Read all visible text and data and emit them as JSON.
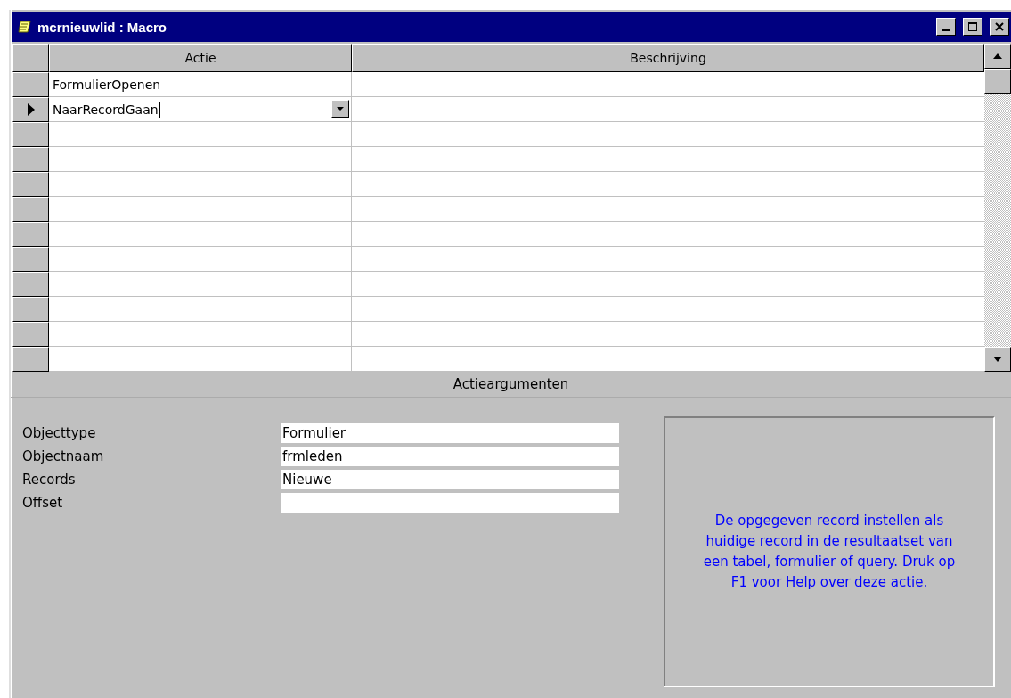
{
  "window": {
    "title": "mcrnieuwlid : Macro"
  },
  "grid": {
    "columns": [
      "Actie",
      "Beschrijving"
    ],
    "rows": [
      {
        "action": "FormulierOpenen",
        "current": false
      },
      {
        "action": "NaarRecordGaan",
        "current": true
      },
      {
        "current": false
      },
      {
        "current": false
      },
      {
        "current": false
      },
      {
        "current": false
      },
      {
        "current": false
      },
      {
        "current": false
      },
      {
        "current": false
      },
      {
        "current": false
      },
      {
        "current": false
      },
      {
        "current": false
      }
    ]
  },
  "arguments": {
    "title": "Actieargumenten",
    "fields": [
      {
        "label": "Objecttype",
        "value": "Formulier"
      },
      {
        "label": "Objectnaam",
        "value": "frmleden"
      },
      {
        "label": "Records",
        "value": "Nieuwe"
      },
      {
        "label": "Offset"
      }
    ],
    "help": "De opgegeven record instellen als huidige record in de resultaatset van een tabel, formulier of query. Druk op F1 voor Help over deze actie."
  }
}
